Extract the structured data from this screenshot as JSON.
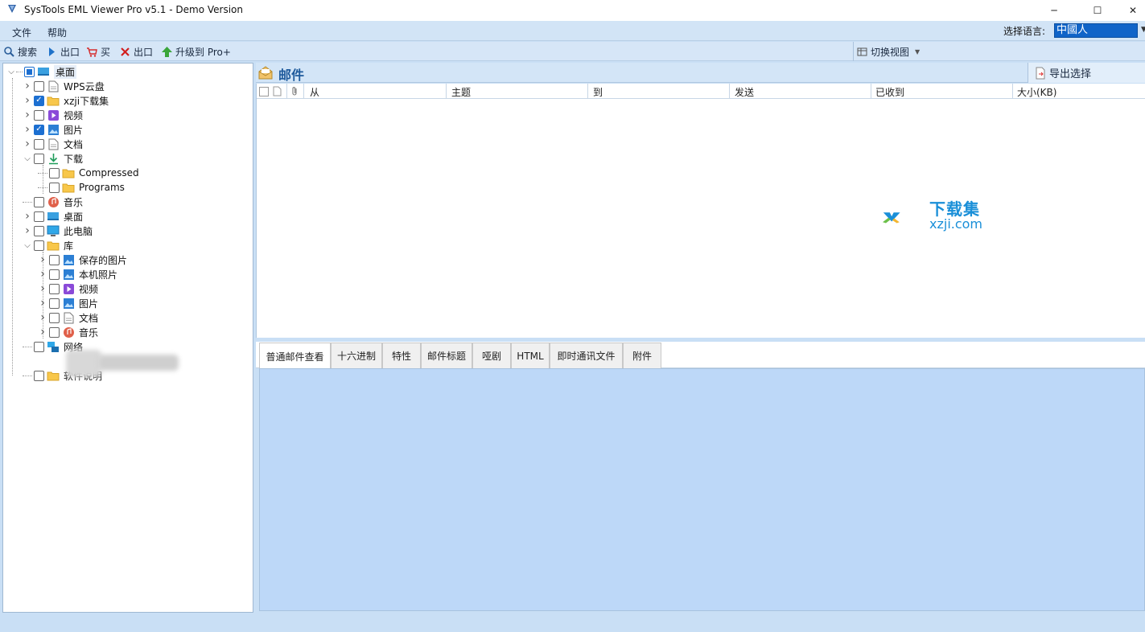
{
  "window": {
    "title": "SysTools EML Viewer Pro v5.1 - Demo Version",
    "minimize_glyph": "─",
    "maximize_glyph": "☐",
    "close_glyph": "✕"
  },
  "menu": {
    "items": [
      "文件",
      "帮助"
    ],
    "language_label": "选择语言:",
    "language_value": "中國人"
  },
  "toolbar": {
    "buttons": [
      {
        "label": "搜索",
        "icon": "search-icon"
      },
      {
        "label": "出口",
        "icon": "play-icon"
      },
      {
        "label": "买",
        "icon": "cart-icon"
      },
      {
        "label": "出口",
        "icon": "close-red-icon"
      },
      {
        "label": "升级到 Pro+",
        "icon": "upgrade-arrow-icon"
      }
    ],
    "switch_view": "切换视图"
  },
  "tree": {
    "root": "桌面",
    "items": [
      {
        "label": "WPS云盘",
        "icon": "document-icon",
        "checked": false
      },
      {
        "label": "xzji下载集",
        "icon": "folder-icon",
        "checked": true
      },
      {
        "label": "视频",
        "icon": "video-icon",
        "checked": false
      },
      {
        "label": "图片",
        "icon": "picture-icon",
        "checked": true
      },
      {
        "label": "文档",
        "icon": "document-icon",
        "checked": false
      },
      {
        "label": "下载",
        "icon": "download-icon",
        "checked": false
      },
      {
        "label": "Compressed",
        "icon": "folder-icon",
        "checked": false
      },
      {
        "label": "Programs",
        "icon": "folder-icon",
        "checked": false
      },
      {
        "label": "音乐",
        "icon": "music-icon",
        "checked": false
      },
      {
        "label": "桌面",
        "icon": "desktop-icon",
        "checked": false
      },
      {
        "label": "此电脑",
        "icon": "computer-icon",
        "checked": false
      },
      {
        "label": "库",
        "icon": "folder-icon",
        "checked": false
      },
      {
        "label": "保存的图片",
        "icon": "picture-icon",
        "checked": false
      },
      {
        "label": "本机照片",
        "icon": "picture-icon",
        "checked": false
      },
      {
        "label": "视频",
        "icon": "video-icon",
        "checked": false
      },
      {
        "label": "图片",
        "icon": "picture-icon",
        "checked": false
      },
      {
        "label": "文档",
        "icon": "document-icon",
        "checked": false
      },
      {
        "label": "音乐",
        "icon": "music-icon",
        "checked": false
      },
      {
        "label": "网络",
        "icon": "network-icon",
        "checked": false
      },
      {
        "label": "软件说明",
        "icon": "folder-icon",
        "checked": false
      }
    ]
  },
  "mail": {
    "title": "邮件",
    "export_selected": "导出选择",
    "columns": [
      "从",
      "主题",
      "到",
      "发送",
      "已收到",
      "大小(KB)"
    ]
  },
  "watermark": {
    "line1": "下载集",
    "line2": "xzji.com"
  },
  "tabs": [
    "普通邮件查看",
    "十六进制",
    "特性",
    "邮件标题",
    "哑剧",
    "HTML",
    "即时通讯文件",
    "附件"
  ],
  "colors": {
    "accent": "#1c6fd1",
    "panel": "#c9dff5",
    "preview": "#bdd8f8",
    "title": "#1e5a9c"
  }
}
